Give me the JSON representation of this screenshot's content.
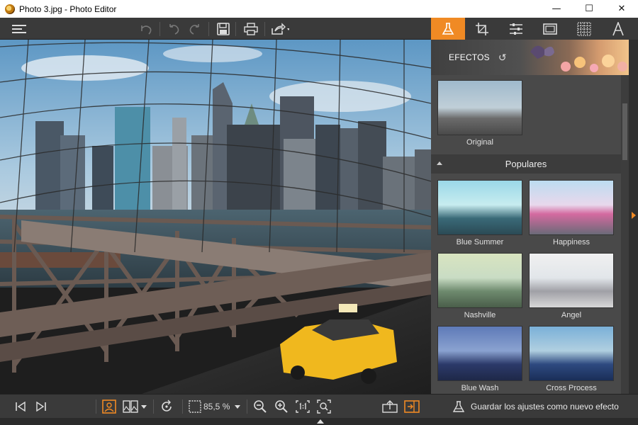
{
  "window": {
    "title": "Photo 3.jpg - Photo Editor",
    "minimize": "—",
    "maximize": "☐",
    "close": "✕"
  },
  "toolbar": {
    "icons": [
      "menu-icon",
      "undo-all-icon",
      "undo-icon",
      "redo-icon",
      "save-icon",
      "print-icon",
      "share-icon"
    ]
  },
  "tabs": [
    {
      "name": "effects",
      "icon": "flask-icon",
      "active": true
    },
    {
      "name": "crop",
      "icon": "crop-icon",
      "active": false
    },
    {
      "name": "adjust",
      "icon": "sliders-icon",
      "active": false
    },
    {
      "name": "frames",
      "icon": "frame-icon",
      "active": false
    },
    {
      "name": "texture",
      "icon": "grid-icon",
      "active": false
    },
    {
      "name": "text",
      "icon": "text-icon",
      "active": false
    }
  ],
  "effects_panel": {
    "header": "EFECTOS",
    "original_label": "Original",
    "section_title": "Populares",
    "effects": [
      {
        "label": "Blue Summer"
      },
      {
        "label": "Happiness"
      },
      {
        "label": "Nashville"
      },
      {
        "label": "Angel"
      },
      {
        "label": "Blue Wash"
      },
      {
        "label": "Cross Process"
      }
    ],
    "save_as_effect": "Guardar los ajustes como nuevo efecto"
  },
  "statusbar": {
    "zoom": "85,5 %"
  },
  "colors": {
    "accent": "#f08a24",
    "toolbar": "#3a3a3a",
    "panel": "#494949"
  }
}
